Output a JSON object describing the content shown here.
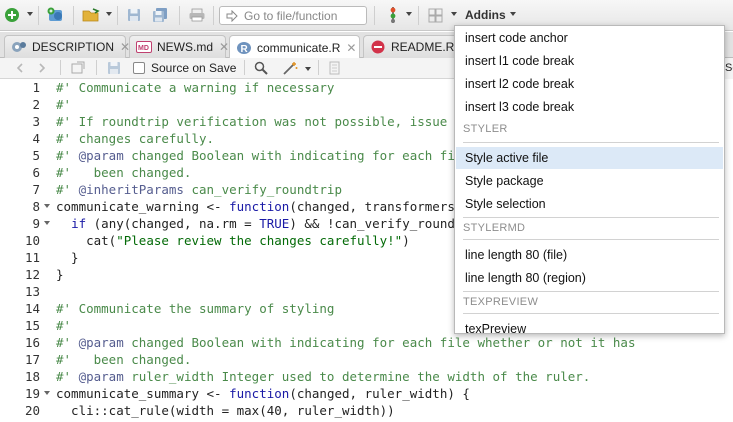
{
  "toolbar": {
    "goto_placeholder": "Go to file/function",
    "addins_label": "Addins"
  },
  "tabs": [
    {
      "label": "DESCRIPTION",
      "icon": "description-file-icon",
      "active": false
    },
    {
      "label": "NEWS.md",
      "icon": "markdown-file-icon",
      "active": false
    },
    {
      "label": "communicate.R",
      "icon": "r-file-icon",
      "active": true
    },
    {
      "label": "README.Rm",
      "icon": "rmarkdown-file-icon",
      "active": false
    }
  ],
  "editor_toolbar": {
    "source_on_save_label": "Source on Save",
    "source_on_save_checked": false,
    "right_edge_text": "Sc"
  },
  "code": {
    "lines": [
      {
        "n": "1",
        "fold": false,
        "tokens": [
          [
            "cmt",
            "#' Communicate a warning if necessary"
          ]
        ]
      },
      {
        "n": "2",
        "fold": false,
        "tokens": [
          [
            "cmt",
            "#'"
          ]
        ]
      },
      {
        "n": "3",
        "fold": false,
        "tokens": [
          [
            "cmt",
            "#' If roundtrip verification was not possible, issue a w"
          ]
        ]
      },
      {
        "n": "4",
        "fold": false,
        "tokens": [
          [
            "cmt",
            "#' changes carefully."
          ]
        ]
      },
      {
        "n": "5",
        "fold": false,
        "tokens": [
          [
            "cmt",
            "#' "
          ],
          [
            "pp",
            "@param"
          ],
          [
            "cmt",
            " changed Boolean with indicating for each file"
          ]
        ]
      },
      {
        "n": "6",
        "fold": false,
        "tokens": [
          [
            "cmt",
            "#'   been changed."
          ]
        ]
      },
      {
        "n": "7",
        "fold": false,
        "tokens": [
          [
            "cmt",
            "#' "
          ],
          [
            "pp",
            "@inheritParams"
          ],
          [
            "cmt",
            " can_verify_roundtrip"
          ]
        ]
      },
      {
        "n": "8",
        "fold": true,
        "tokens": [
          [
            "",
            "communicate_warning <- "
          ],
          [
            "kw",
            "function"
          ],
          [
            "",
            "(changed, transformers)"
          ]
        ]
      },
      {
        "n": "9",
        "fold": true,
        "tokens": [
          [
            "",
            "  "
          ],
          [
            "kw",
            "if"
          ],
          [
            "",
            " (any(changed, na.rm = "
          ],
          [
            "kw",
            "TRUE"
          ],
          [
            "",
            ") && !can_verify_roundtr"
          ]
        ]
      },
      {
        "n": "10",
        "fold": false,
        "tokens": [
          [
            "",
            "    cat("
          ],
          [
            "str",
            "\"Please review the changes carefully!\""
          ],
          [
            "",
            ")"
          ]
        ]
      },
      {
        "n": "11",
        "fold": false,
        "tokens": [
          [
            "",
            "  }"
          ]
        ]
      },
      {
        "n": "12",
        "fold": false,
        "tokens": [
          [
            "",
            "}"
          ]
        ]
      },
      {
        "n": "13",
        "fold": false,
        "tokens": []
      },
      {
        "n": "14",
        "fold": false,
        "tokens": [
          [
            "cmt",
            "#' Communicate the summary of styling"
          ]
        ]
      },
      {
        "n": "15",
        "fold": false,
        "tokens": [
          [
            "cmt",
            "#'"
          ]
        ]
      },
      {
        "n": "16",
        "fold": false,
        "tokens": [
          [
            "cmt",
            "#' "
          ],
          [
            "pp",
            "@param"
          ],
          [
            "cmt",
            " changed Boolean with indicating for each file whether or not it has"
          ]
        ]
      },
      {
        "n": "17",
        "fold": false,
        "tokens": [
          [
            "cmt",
            "#'   been changed."
          ]
        ]
      },
      {
        "n": "18",
        "fold": false,
        "tokens": [
          [
            "cmt",
            "#' "
          ],
          [
            "pp",
            "@param"
          ],
          [
            "cmt",
            " ruler_width Integer used to determine the width of the ruler."
          ]
        ]
      },
      {
        "n": "19",
        "fold": true,
        "tokens": [
          [
            "",
            "communicate_summary <- "
          ],
          [
            "kw",
            "function"
          ],
          [
            "",
            "(changed, ruler_width) {"
          ]
        ]
      },
      {
        "n": "20",
        "fold": false,
        "tokens": [
          [
            "",
            "  cli::cat_rule(width = max(40, ruler_width))"
          ]
        ]
      }
    ]
  },
  "addins_menu": {
    "items": [
      {
        "kind": "item",
        "label": "insert code anchor"
      },
      {
        "kind": "item",
        "label": "insert l1 code break"
      },
      {
        "kind": "item",
        "label": "insert l2 code break"
      },
      {
        "kind": "item",
        "label": "insert l3 code break"
      },
      {
        "kind": "header",
        "label": "STYLER"
      },
      {
        "kind": "item",
        "label": "Style active file",
        "highlighted": true
      },
      {
        "kind": "item",
        "label": "Style package"
      },
      {
        "kind": "item",
        "label": "Style selection"
      },
      {
        "kind": "header",
        "label": "STYLERMD"
      },
      {
        "kind": "item",
        "label": "line length 80 (file)"
      },
      {
        "kind": "item",
        "label": "line length 80 (region)"
      },
      {
        "kind": "header",
        "label": "TEXPREVIEW"
      },
      {
        "kind": "item",
        "label": "texPreview"
      }
    ]
  },
  "colors": {
    "comment": "#4a8a4a",
    "roxygen_tag": "#555d8f",
    "keyword": "#1a1aa6",
    "string": "#036a07",
    "menu_highlight": "#dce9f7"
  }
}
